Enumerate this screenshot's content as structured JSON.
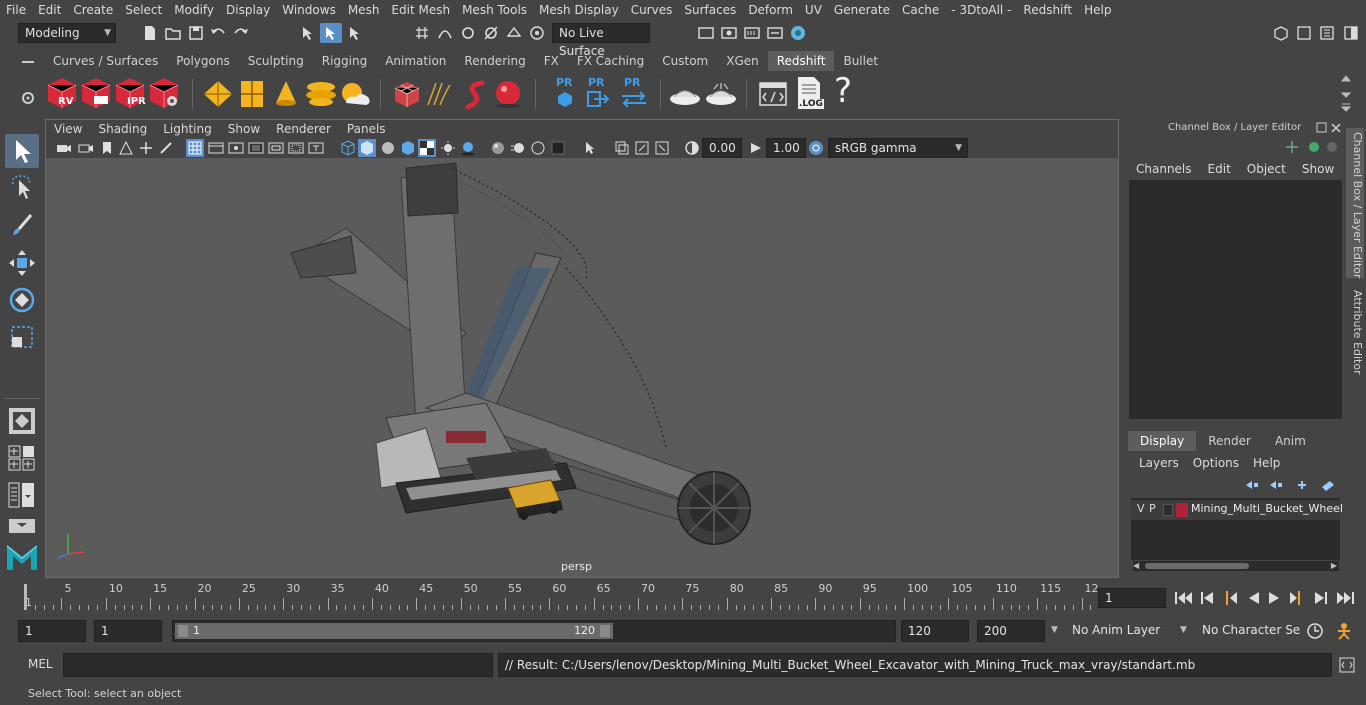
{
  "menubar": {
    "items": [
      "File",
      "Edit",
      "Create",
      "Select",
      "Modify",
      "Display",
      "Windows",
      "Mesh",
      "Edit Mesh",
      "Mesh Tools",
      "Mesh Display",
      "Curves",
      "Surfaces",
      "Deform",
      "UV",
      "Generate",
      "Cache",
      "- 3DtoAll -",
      "Redshift",
      "Help"
    ]
  },
  "statusline": {
    "mode": "Modeling",
    "live_surface": "No Live Surface"
  },
  "shelf": {
    "tabs": [
      "Curves / Surfaces",
      "Polygons",
      "Sculpting",
      "Rigging",
      "Animation",
      "Rendering",
      "FX",
      "FX Caching",
      "Custom",
      "XGen",
      "Redshift",
      "Bullet"
    ],
    "active_tab": "Redshift",
    "icon_labels": [
      "RV",
      "IPR",
      "PR",
      "PR",
      "PR",
      ".LOG",
      "?"
    ]
  },
  "viewport": {
    "menu": [
      "View",
      "Shading",
      "Lighting",
      "Show",
      "Renderer",
      "Panels"
    ],
    "exposure": "0.00",
    "gamma": "1.00",
    "colorspace": "sRGB gamma",
    "camera_label": "persp"
  },
  "right_panel": {
    "title": "Channel Box / Layer Editor",
    "menu": [
      "Channels",
      "Edit",
      "Object",
      "Show"
    ],
    "layer_tabs": [
      "Display",
      "Render",
      "Anim"
    ],
    "active_layer_tab": "Display",
    "layer_menu": [
      "Layers",
      "Options",
      "Help"
    ],
    "layer": {
      "v": "V",
      "p": "P",
      "name": "Mining_Multi_Bucket_Wheel",
      "color": "#b0223a"
    },
    "vertical_tabs": [
      "Channel Box / Layer Editor",
      "Attribute Editor"
    ]
  },
  "timeline": {
    "ticks": [
      "5",
      "10",
      "15",
      "20",
      "25",
      "30",
      "35",
      "40",
      "45",
      "50",
      "55",
      "60",
      "65",
      "70",
      "75",
      "80",
      "85",
      "90",
      "95",
      "100",
      "105",
      "110",
      "115",
      "12"
    ],
    "start_marker": "1",
    "current_frame": "1"
  },
  "range": {
    "start": "1",
    "playback_start": "1",
    "slider_start": "1",
    "slider_end": "120",
    "playback_end": "120",
    "end": "200",
    "anim_layer": "No Anim Layer",
    "character_set": "No Character Set"
  },
  "cmdline": {
    "lang": "MEL",
    "result": "// Result: C:/Users/lenov/Desktop/Mining_Multi_Bucket_Wheel_Excavator_with_Mining_Truck_max_vray/standart.mb"
  },
  "helpline": {
    "text": "Select Tool: select an object"
  },
  "colors": {
    "accent_blue": "#5a8fc8",
    "redshift_red": "#d8293a",
    "bg": "#444444",
    "field": "#2b2b2b"
  }
}
